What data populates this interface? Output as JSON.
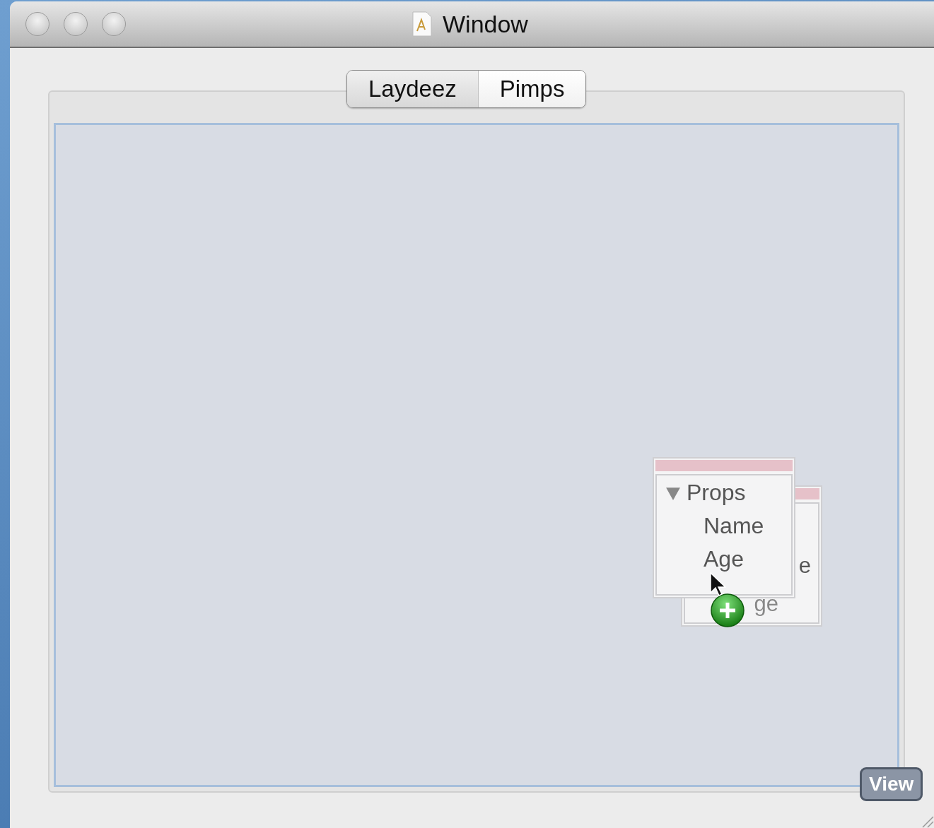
{
  "window": {
    "title": "Window"
  },
  "tabs": [
    {
      "label": "Laydeez",
      "selected": true
    },
    {
      "label": "Pimps",
      "selected": false
    }
  ],
  "drag_cards": [
    {
      "items": [
        {
          "label": "e"
        },
        {
          "label": "ge"
        }
      ]
    },
    {
      "group": {
        "label": "Props",
        "expanded": true
      },
      "items": [
        {
          "label": "Name"
        },
        {
          "label": "Age"
        }
      ]
    }
  ],
  "view_badge": "View"
}
